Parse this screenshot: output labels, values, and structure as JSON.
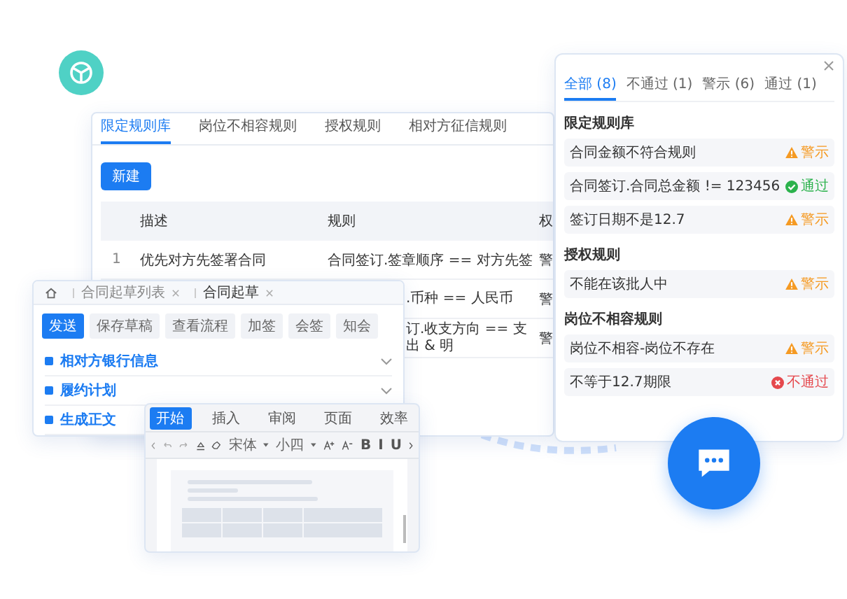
{
  "rules_window": {
    "tabs": [
      {
        "label": "限定规则库",
        "selected": true
      },
      {
        "label": "岗位不相容规则",
        "selected": false
      },
      {
        "label": "授权规则",
        "selected": false
      },
      {
        "label": "相对方征信规则",
        "selected": false
      }
    ],
    "new_button": "新建",
    "columns": [
      "描述",
      "规则",
      "权"
    ],
    "rows": [
      {
        "index": "1",
        "description": "优先对方先签署合同",
        "rule": "合同签订.签章顺序 == 对方先签",
        "column_3": "警"
      },
      {
        "rule": ".币种 == 人民币",
        "column_3": "警"
      },
      {
        "rule": "订.收支方向 == 支出 & 明",
        "column_3": "警"
      }
    ]
  },
  "draft_window": {
    "breadcrumbs": [
      {
        "label": "合同起草列表",
        "selected": false
      },
      {
        "label": "合同起草",
        "selected": true
      }
    ],
    "actions": [
      {
        "label": "发送",
        "primary": true
      },
      {
        "label": "保存草稿",
        "primary": false
      },
      {
        "label": "查看流程",
        "primary": false
      },
      {
        "label": "加签",
        "primary": false
      },
      {
        "label": "会签",
        "primary": false
      },
      {
        "label": "知会",
        "primary": false
      }
    ],
    "sections": [
      "相对方银行信息",
      "履约计划",
      "生成正文"
    ]
  },
  "editor_window": {
    "tabs": [
      {
        "label": "开始",
        "selected": true
      },
      {
        "label": "插入",
        "selected": false
      },
      {
        "label": "审阅",
        "selected": false
      },
      {
        "label": "页面",
        "selected": false
      },
      {
        "label": "效率",
        "selected": false
      }
    ],
    "font": "宋体",
    "size": "小四",
    "format_buttons": [
      "B",
      "I",
      "U"
    ]
  },
  "check_panel": {
    "tabs": [
      {
        "label": "全部 (8)",
        "selected": true
      },
      {
        "label": "不通过 (1)",
        "selected": false
      },
      {
        "label": "警示 (6)",
        "selected": false
      },
      {
        "label": "通过 (1)",
        "selected": false
      }
    ],
    "groups": [
      {
        "title": "限定规则库",
        "items": [
          {
            "text": "合同金额不符合规则",
            "kind": "warn",
            "status_label": "警示"
          },
          {
            "text": "合同签订.合同总金额 != 123456",
            "kind": "pass",
            "status_label": "通过"
          },
          {
            "text": "签订日期不是12.7",
            "kind": "warn",
            "status_label": "警示"
          }
        ]
      },
      {
        "title": "授权规则",
        "items": [
          {
            "text": "不能在该批人中",
            "kind": "warn",
            "status_label": "警示"
          }
        ]
      },
      {
        "title": "岗位不相容规则",
        "items": [
          {
            "text": "岗位不相容-岗位不存在",
            "kind": "warn",
            "status_label": "警示"
          },
          {
            "text": "不等于12.7期限",
            "kind": "fail",
            "status_label": "不通过"
          }
        ]
      }
    ]
  }
}
